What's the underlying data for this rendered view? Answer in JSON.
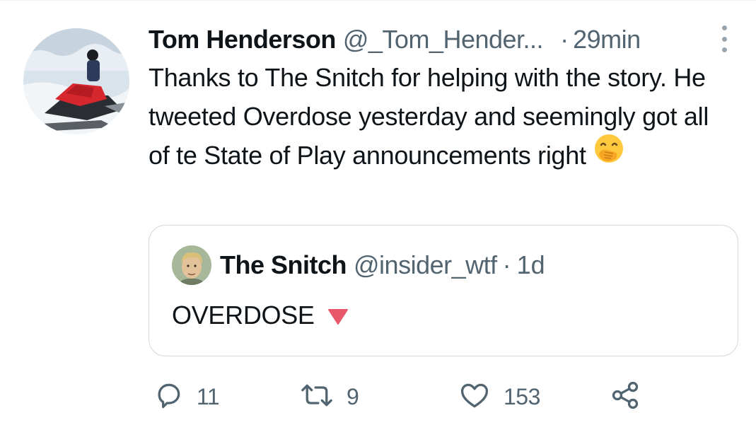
{
  "tweet": {
    "author_name": "Tom Henderson",
    "author_handle": "@_Tom_Hender...",
    "separator": "·",
    "time": "29min",
    "text": "Thanks to The Snitch for helping with the story. He tweeted Overdose yesterday and seemingly got all of te State of Play announcements right",
    "emoji_icon": "face-with-hand-over-mouth-emoji"
  },
  "quoted_tweet": {
    "author_name": "The Snitch",
    "author_handle": "@insider_wtf",
    "separator": "·",
    "time": "1d",
    "text": "OVERDOSE",
    "emoji_icon": "red-triangle-pointed-down-emoji"
  },
  "actions": {
    "reply": {
      "icon": "reply-icon",
      "count": "11"
    },
    "retweet": {
      "icon": "retweet-icon",
      "count": "9"
    },
    "like": {
      "icon": "heart-icon",
      "count": "153"
    },
    "share": {
      "icon": "share-icon"
    }
  },
  "colors": {
    "text": "#0f1419",
    "secondary": "#536471",
    "border": "#cfd9de",
    "emoji_yellow": "#ffc83d",
    "triangle_red": "#e8576a"
  }
}
